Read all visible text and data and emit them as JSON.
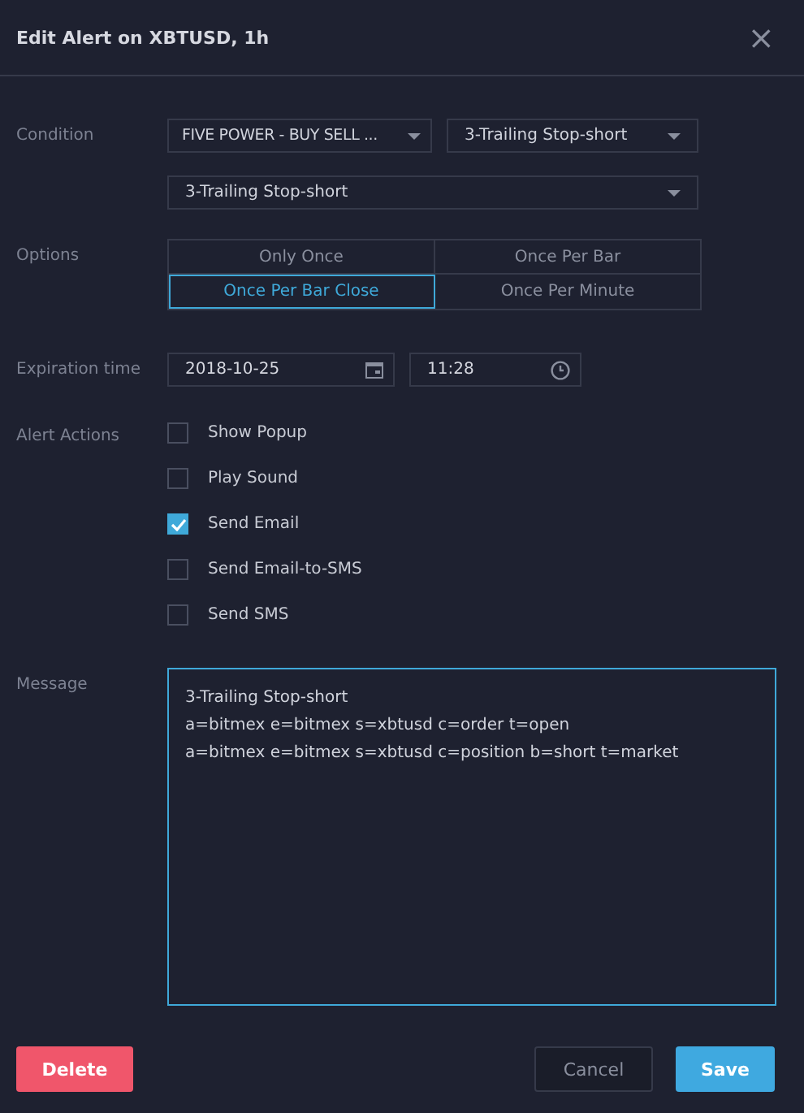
{
  "window": {
    "title": "Edit Alert on XBTUSD, 1h",
    "close": "×"
  },
  "condition": {
    "label": "Condition",
    "selects": [
      {
        "value": "FIVE POWER - BUY SELL ..."
      },
      {
        "value": "3-Trailing Stop-short"
      }
    ],
    "wide_select": {
      "value": "3-Trailing Stop-short"
    }
  },
  "options": {
    "label": "Options",
    "items": [
      {
        "label": "Only Once",
        "selected": false
      },
      {
        "label": "Once Per Bar",
        "selected": false
      },
      {
        "label": "Once Per Bar Close",
        "selected": true
      },
      {
        "label": "Once Per Minute",
        "selected": false
      }
    ]
  },
  "expiration": {
    "label": "Expiration time",
    "date": "2018-10-25",
    "time": "11:28"
  },
  "alert_actions": {
    "label": "Alert Actions",
    "items": [
      {
        "label": "Show Popup",
        "checked": false
      },
      {
        "label": "Play Sound",
        "checked": false
      },
      {
        "label": "Send Email",
        "checked": true
      },
      {
        "label": "Send Email-to-SMS",
        "checked": false
      },
      {
        "label": "Send SMS",
        "checked": false
      }
    ]
  },
  "message": {
    "label": "Message",
    "lines": [
      "3-Trailing Stop-short",
      "a=bitmex e=bitmex s=xbtusd c=order t=open",
      "a=bitmex e=bitmex s=xbtusd c=position b=short t=market"
    ]
  },
  "buttons": {
    "delete": "Delete",
    "cancel": "Cancel",
    "save": "Save"
  }
}
